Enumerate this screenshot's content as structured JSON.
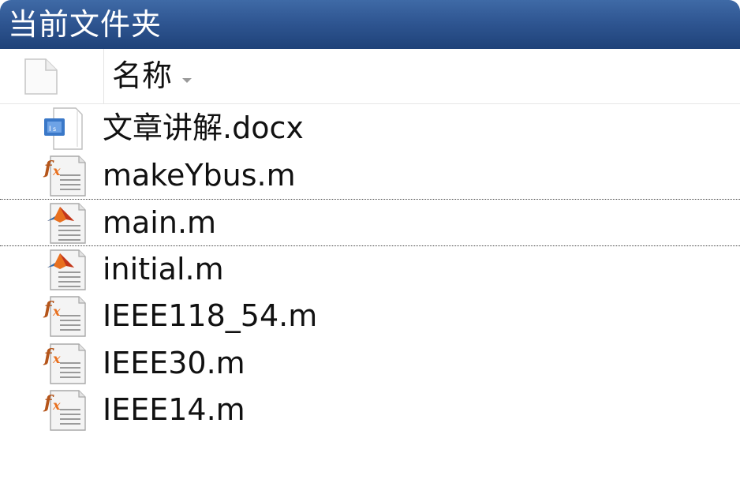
{
  "panel": {
    "title": "当前文件夹"
  },
  "header": {
    "type_column_icon": "blank-document-icon",
    "name_column_label": "名称",
    "sort_indicator": "sort-arrow-down-icon"
  },
  "files": [
    {
      "name": "文章讲解.docx",
      "icon": "word-document-icon",
      "selected": false
    },
    {
      "name": "makeYbus.m",
      "icon": "matlab-function-icon",
      "selected": false
    },
    {
      "name": "main.m",
      "icon": "matlab-script-icon",
      "selected": true
    },
    {
      "name": "initial.m",
      "icon": "matlab-script-icon",
      "selected": false
    },
    {
      "name": "IEEE118_54.m",
      "icon": "matlab-function-icon",
      "selected": false
    },
    {
      "name": "IEEE30.m",
      "icon": "matlab-function-icon",
      "selected": false
    },
    {
      "name": "IEEE14.m",
      "icon": "matlab-function-icon",
      "selected": false
    }
  ],
  "colors": {
    "titlebar": "#2f5692",
    "title_text": "#ffffff",
    "matlab_orange": "#e8701f",
    "function_fx": "#b5551a"
  }
}
